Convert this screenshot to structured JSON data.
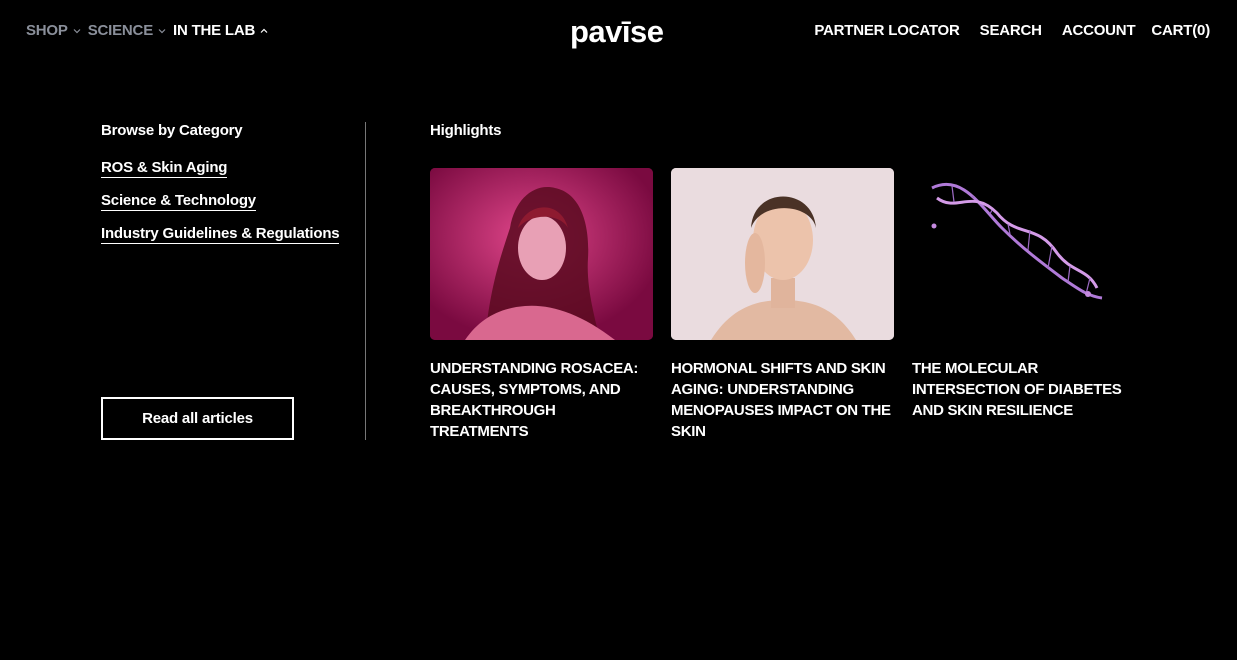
{
  "header": {
    "nav_left": [
      {
        "label": "SHOP",
        "icon": "chevron-down-icon"
      },
      {
        "label": "SCIENCE",
        "icon": "chevron-down-icon"
      },
      {
        "label": "IN THE LAB",
        "icon": "chevron-up-icon"
      }
    ],
    "logo": "pavīse",
    "nav_right": {
      "partner_locator": "PARTNER LOCATOR",
      "search": "SEARCH",
      "account": "ACCOUNT",
      "cart": "CART(0)"
    }
  },
  "menu": {
    "browse_title": "Browse by Category",
    "categories": [
      "ROS & Skin Aging",
      "Science & Technology",
      "Industry Guidelines & Regulations"
    ],
    "read_all": "Read all articles",
    "highlights_title": "Highlights",
    "articles": [
      {
        "title": "UNDERSTANDING ROSACEA: CAUSES, SYMPTOMS, AND BREAKTHROUGH TREATMENTS"
      },
      {
        "title": "HORMONAL SHIFTS AND SKIN AGING: UNDERSTANDING MENOPAUSES IMPACT ON THE SKIN"
      },
      {
        "title": "THE MOLECULAR INTERSECTION OF DIABETES AND SKIN RESILIENCE"
      }
    ]
  },
  "colors": {
    "background": "#000000",
    "text": "#ffffff",
    "dim_nav": "#8a8f9a",
    "accent_magenta": "#c8306e",
    "dna_purple": "#b07ad8"
  }
}
